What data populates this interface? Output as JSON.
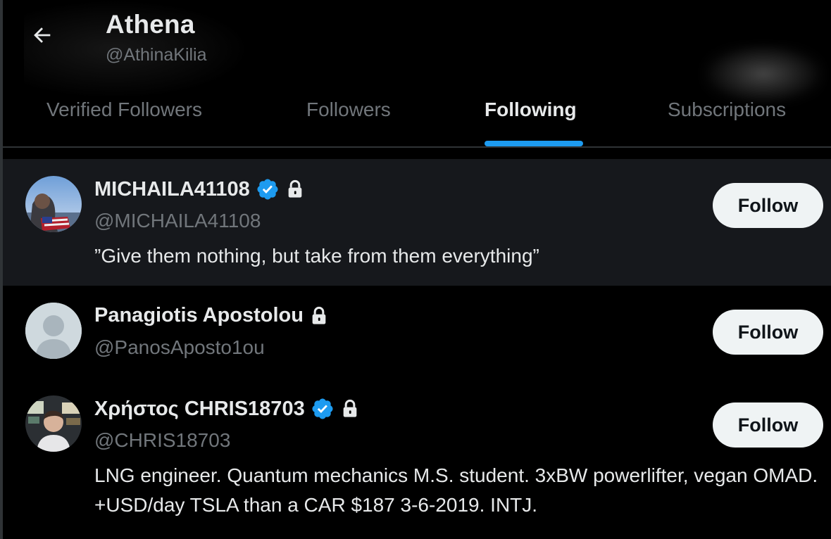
{
  "header": {
    "name": "Athena",
    "handle": "@AthinaKilia",
    "back_icon": "arrow-left-icon"
  },
  "tabs": [
    {
      "label": "Verified Followers",
      "active": false
    },
    {
      "label": "Followers",
      "active": false
    },
    {
      "label": "Following",
      "active": true
    },
    {
      "label": "Subscriptions",
      "active": false
    }
  ],
  "users": [
    {
      "name": "MICHAILA41108",
      "handle": "@MICHAILA41108",
      "verified": true,
      "protected": true,
      "bio": "”Give them nothing, but take from them everything”",
      "follow_label": "Follow",
      "avatar": "photo-avatar"
    },
    {
      "name": "Panagiotis Apostolou",
      "handle": "@PanosAposto1ou",
      "verified": false,
      "protected": true,
      "bio": "",
      "follow_label": "Follow",
      "avatar": "default-avatar"
    },
    {
      "name": "Χρήστος CHRIS18703",
      "handle": "@CHRIS18703",
      "verified": true,
      "protected": true,
      "bio": "LNG engineer. Quantum mechanics M.S. student. 3xBW powerlifter, vegan OMAD. +USD/day TSLA than a CAR $187 3-6-2019. INTJ.",
      "follow_label": "Follow",
      "avatar": "photo-avatar"
    }
  ],
  "colors": {
    "accent": "#1d9bf0",
    "background": "#000000",
    "secondary_text": "#71767b",
    "button_bg": "#eff3f4"
  }
}
